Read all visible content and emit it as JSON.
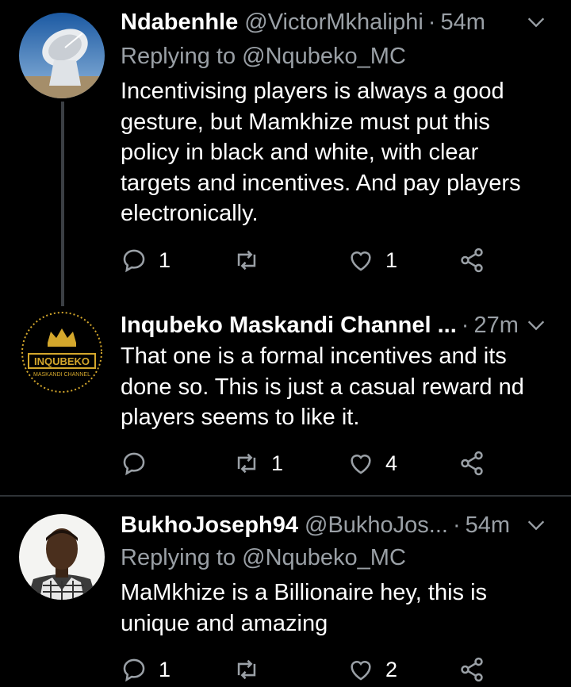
{
  "tweets": [
    {
      "name": "Ndabenhle",
      "handle": "@VictorMkhaliphi",
      "dot": "·",
      "time": "54m",
      "replying": "Replying to @Nqubeko_MC",
      "body": "Incentivising players is always a good gesture, but Mamkhize must put this policy in black and white, with clear targets and incentives. And pay players electronically.",
      "replies": "1",
      "retweets": "",
      "likes": "1",
      "avatar": "satellite-dish-avatar"
    },
    {
      "name": "Inqubeko Maskandi Channel ...",
      "handle": "",
      "dot": "·",
      "time": "27m",
      "replying": "",
      "body": "That one is a formal incentives and its done so. This is just a casual reward nd players seems to like it.",
      "replies": "",
      "retweets": "1",
      "likes": "4",
      "avatar": "inqubeko-logo-avatar",
      "logo_text": "INQUBEKO",
      "logo_sub": "MASKANDI CHANNEL"
    },
    {
      "name": "BukhoJoseph94",
      "handle": "@BukhoJos...",
      "dot": "·",
      "time": "54m",
      "replying": "Replying to @Nqubeko_MC",
      "body": "MaMkhize is a Billionaire hey, this is unique and amazing",
      "replies": "1",
      "retweets": "",
      "likes": "2",
      "avatar": "profile-photo-avatar"
    }
  ],
  "colors": {
    "background": "#000000",
    "text": "#ffffff",
    "secondary": "#9aa0a6",
    "separator": "#2f3336",
    "thread_line": "#3b3f44"
  },
  "icons": [
    "reply-icon",
    "retweet-icon",
    "like-icon",
    "share-icon",
    "chevron-down-icon"
  ]
}
